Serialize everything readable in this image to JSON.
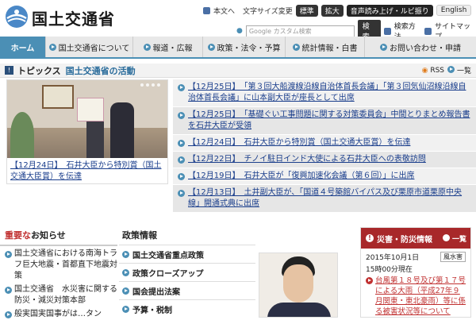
{
  "header": {
    "site_name": "国土交通省",
    "util": {
      "main_text": "本文へ",
      "font_size": "文字サイズ変更",
      "size_standard": "標準",
      "size_large": "拡大",
      "voice": "音声読み上げ・ルビ振り",
      "english": "English"
    },
    "search": {
      "placeholder": "Google カスタム検索",
      "button": "検索",
      "search_method": "検索方法",
      "sitemap": "サイトマップ"
    }
  },
  "gnav": [
    {
      "label": "ホーム"
    },
    {
      "label": "国土交通省について"
    },
    {
      "label": "報道・広報"
    },
    {
      "label": "政策・法令・予算"
    },
    {
      "label": "統計情報・白書"
    },
    {
      "label": "お問い合わせ・申請"
    }
  ],
  "topics": {
    "label": "トピックス",
    "sub": "国土交通省の活動",
    "rss": "RSS",
    "list_all": "一覧",
    "feature_caption": "【12月24日】　石井大臣から特別賞（国土交通大臣賞）を伝達",
    "news": [
      {
        "text": "【12月25日】　「第３回大船渡線沿線自治体首長会議」「第３回気仙沼線沿線自治体首長会議」に山本副大臣が座長として出席"
      },
      {
        "text": "【12月25日】　「基礎ぐい工事問題に関する対策委員会」中間とりまとめ報告書を石井大臣が受領"
      },
      {
        "text": "【12月24日】　石井大臣から特別賞（国土交通大臣賞）を伝達"
      },
      {
        "text": "【12月22日】　チノイ駐日インド大使による石井大臣への表敬訪問"
      },
      {
        "text": "【12月19日】　石井大臣が「復興加速化会議（第６回）」に出席"
      },
      {
        "text": "【12月13日】　土井副大臣が、「国道４号築館バイパス及び栗原市道栗原中央線」開通式典に出席"
      }
    ]
  },
  "important": {
    "head_red": "重要な",
    "head_rest": "お知らせ",
    "items": [
      {
        "text": "国土交通省における南海トラフ巨大地震・首都直下地震対策"
      },
      {
        "text": "国土交通省　水災害に関する防災・減災対策本部"
      },
      {
        "text": "般実国実国事がは…タン"
      }
    ]
  },
  "policy": {
    "head": "政策情報",
    "items": [
      {
        "text": "国土交通省重点政策"
      },
      {
        "text": "政策クローズアップ"
      },
      {
        "text": "国会提出法案"
      },
      {
        "text": "予算・税制"
      }
    ]
  },
  "disaster": {
    "head": "災害・防災情報",
    "all": "一覧",
    "date": "2015年10月1日",
    "tag": "風水害",
    "time": "15時00分現在",
    "item": "台風第１８号及び第１７号による大雨（平成27年９月関東・東北豪雨）等に係る被害状況等について"
  },
  "colors": {
    "accent": "#4b8fb5",
    "link": "#1a3e8c",
    "disaster": "#a8282a"
  }
}
